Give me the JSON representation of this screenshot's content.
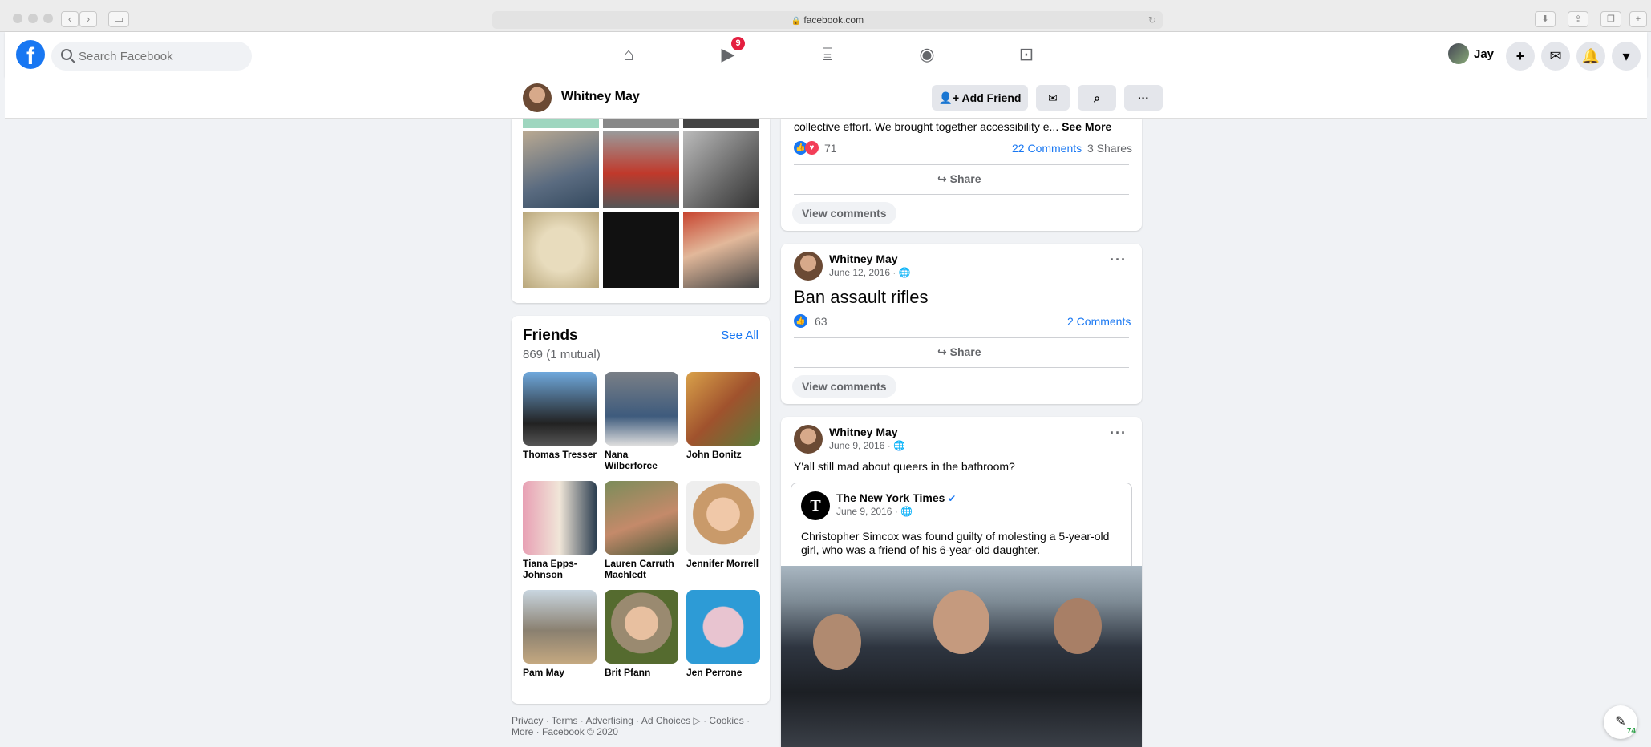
{
  "browser": {
    "url": "facebook.com"
  },
  "topbar": {
    "search_placeholder": "Search Facebook",
    "watch_badge": "9",
    "user_name": "Jay"
  },
  "profile_header": {
    "name": "Whitney May",
    "add_friend": "Add Friend"
  },
  "friends": {
    "title": "Friends",
    "count": "869 (1 mutual)",
    "see_all": "See All",
    "items": [
      {
        "name": "Thomas Tresser"
      },
      {
        "name": "Nana Wilberforce"
      },
      {
        "name": "John Bonitz"
      },
      {
        "name": "Tiana Epps-Johnson"
      },
      {
        "name": "Lauren Carruth Machledt"
      },
      {
        "name": "Jennifer Morrell"
      },
      {
        "name": "Pam May"
      },
      {
        "name": "Brit Pfann"
      },
      {
        "name": "Jen Perrone"
      }
    ]
  },
  "footer": {
    "line1": "Privacy · Terms · Advertising · Ad Choices ▷ · Cookies ·",
    "line2": "More · Facebook © 2020"
  },
  "post1": {
    "text": "collective effort. We brought together accessibility e...",
    "see_more": "See More",
    "reactions": "71",
    "comments": "22 Comments",
    "shares": "3 Shares",
    "share_label": "Share",
    "view_comments": "View comments"
  },
  "post2": {
    "author": "Whitney May",
    "date": "June 12, 2016 ·",
    "text": "Ban assault rifles",
    "reactions": "63",
    "comments": "2 Comments",
    "share_label": "Share",
    "view_comments": "View comments"
  },
  "post3": {
    "author": "Whitney May",
    "date": "June 9, 2016 ·",
    "text": "Y'all still mad about queers in the bathroom?",
    "shared": {
      "source": "The New York Times",
      "date": "June 9, 2016 ·",
      "text": "Christopher Simcox was found guilty of molesting a 5-year-old girl, who was a friend of his 6-year-old daughter."
    }
  },
  "chat_badge": "74",
  "colors": {
    "brand": "#1877f2",
    "badge": "#e41e3f",
    "bg": "#f0f2f5"
  }
}
